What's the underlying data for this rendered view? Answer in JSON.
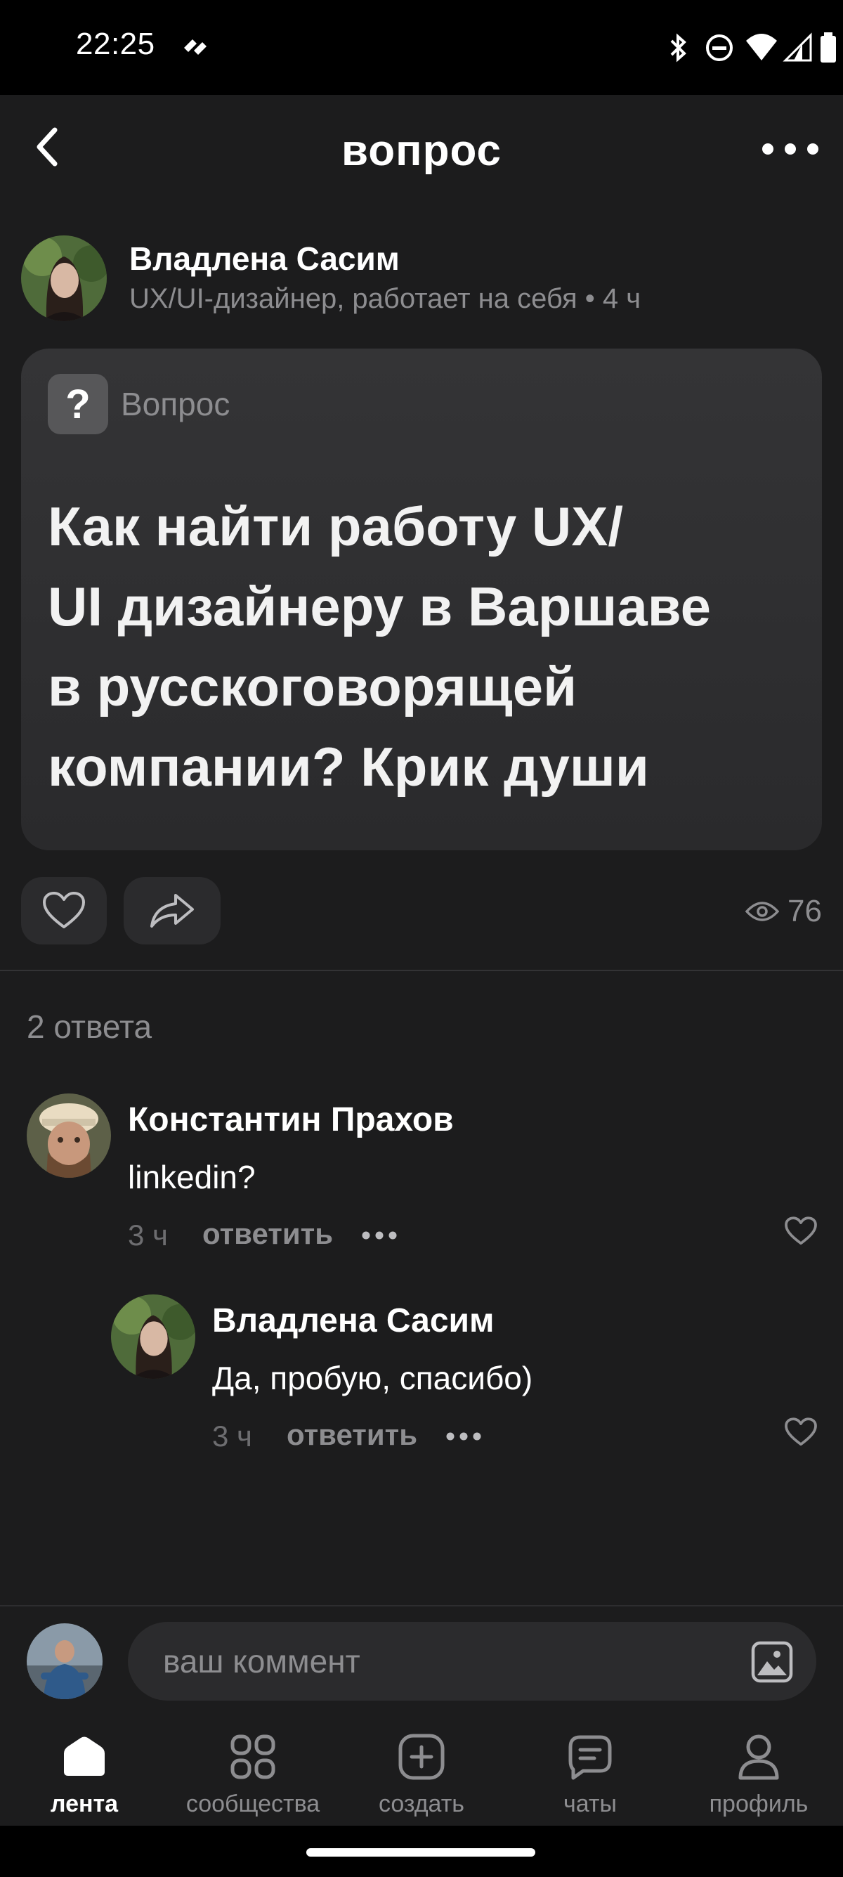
{
  "status_bar": {
    "time": "22:25"
  },
  "header": {
    "title": "вопрос",
    "back_icon": "chevron-left-icon",
    "more_icon": "more-horizontal-icon"
  },
  "post": {
    "author_name": "Владлена Сасим",
    "author_meta": "UX/UI-дизайнер, работает на себя • 4 ч",
    "badge_icon": "?",
    "badge_label": "Вопрос",
    "question_lines": [
      "Как найти работу UX/",
      "UI дизайнеру в Варшаве",
      "в русскоговорящей",
      "компании? Крик души"
    ],
    "views": "76"
  },
  "answers": {
    "count_label": "2 ответа",
    "items": [
      {
        "author": "Константин Прахов",
        "text": "linkedin?",
        "time": "3 ч",
        "reply_label": "ответить"
      },
      {
        "author": "Владлена Сасим",
        "text": "Да, пробую, спасибо)",
        "time": "3 ч",
        "reply_label": "ответить"
      }
    ]
  },
  "composer": {
    "placeholder": "ваш коммент"
  },
  "bottom_nav": {
    "items": [
      {
        "label": "лента",
        "icon": "home-icon",
        "active": true
      },
      {
        "label": "сообщества",
        "icon": "grid-icon",
        "active": false
      },
      {
        "label": "создать",
        "icon": "plus-square-icon",
        "active": false
      },
      {
        "label": "чаты",
        "icon": "chat-icon",
        "active": false
      },
      {
        "label": "профиль",
        "icon": "user-icon",
        "active": false
      }
    ]
  },
  "colors": {
    "background": "#1c1c1d",
    "card": "#303032",
    "muted_text": "#8d8d90",
    "primary_text": "#ffffff"
  }
}
